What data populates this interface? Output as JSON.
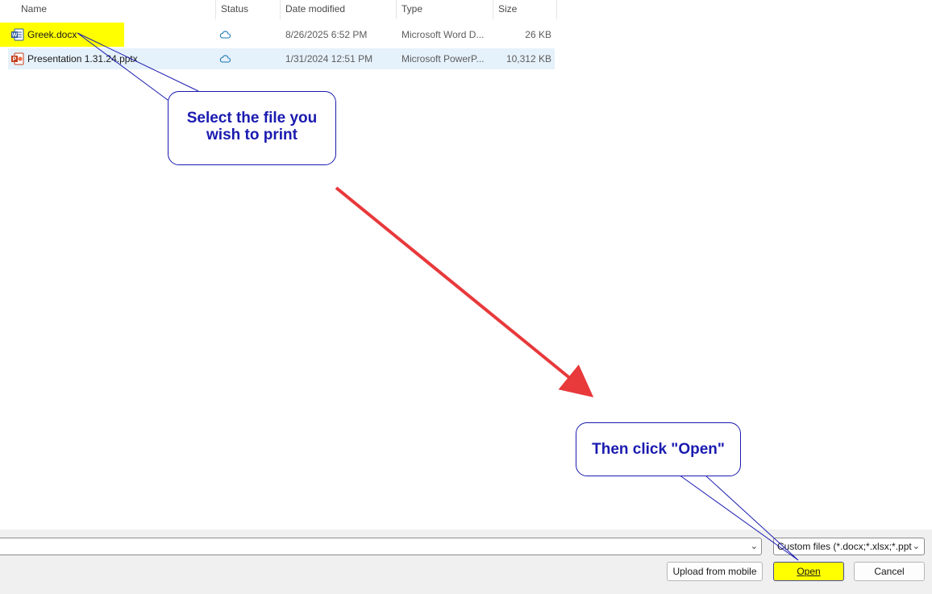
{
  "header": {
    "name": "Name",
    "status": "Status",
    "date_modified": "Date modified",
    "type": "Type",
    "size": "Size",
    "sort_glyph": "^"
  },
  "files": [
    {
      "name": "Greek.docx",
      "icon": "word-doc-icon",
      "status_icon": "cloud-icon",
      "date_modified": "8/26/2025 6:52 PM",
      "type": "Microsoft Word D...",
      "size": "26 KB"
    },
    {
      "name": "Presentation 1.31.24.pptx",
      "icon": "powerpoint-doc-icon",
      "status_icon": "cloud-icon",
      "date_modified": "1/31/2024 12:51 PM",
      "type": "Microsoft PowerP...",
      "size": "10,312 KB"
    }
  ],
  "annotations": {
    "callout_select_line1": "Select the file you",
    "callout_select_line2": "wish to print",
    "callout_open": "Then click \"Open\"",
    "highlight_color": "#ffff00",
    "callout_color": "#1a1ab0",
    "arrow_color": "#e8393b"
  },
  "footer": {
    "filename_value": "",
    "file_type_filter": "Custom files (*.docx;*.xlsx;*.ppt",
    "upload_button": "Upload from mobile",
    "open_button": "Open",
    "cancel_button": "Cancel"
  }
}
